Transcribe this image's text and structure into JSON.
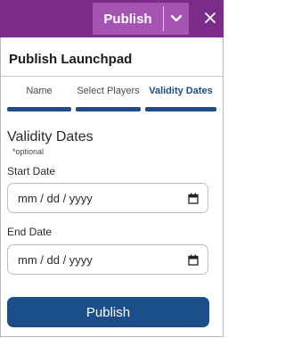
{
  "header": {
    "publish_label": "Publish",
    "chevron_icon": "chevron-down-icon",
    "close_icon": "close-icon",
    "bar_color": "#7b2c8a"
  },
  "panel": {
    "title": "Publish Launchpad"
  },
  "tabs": [
    {
      "label": "Name",
      "active": false
    },
    {
      "label": "Select Players",
      "active": false
    },
    {
      "label": "Validity Dates",
      "active": true
    }
  ],
  "section": {
    "title": "Validity Dates",
    "note": "*optional"
  },
  "fields": {
    "start_label": "Start Date",
    "start_placeholder": "mm / dd / yyyy",
    "end_label": "End Date",
    "end_placeholder": "mm / dd / yyyy",
    "calendar_icon": "calendar-icon"
  },
  "footer": {
    "publish_label": "Publish",
    "accent_color": "#1c4e8c"
  }
}
